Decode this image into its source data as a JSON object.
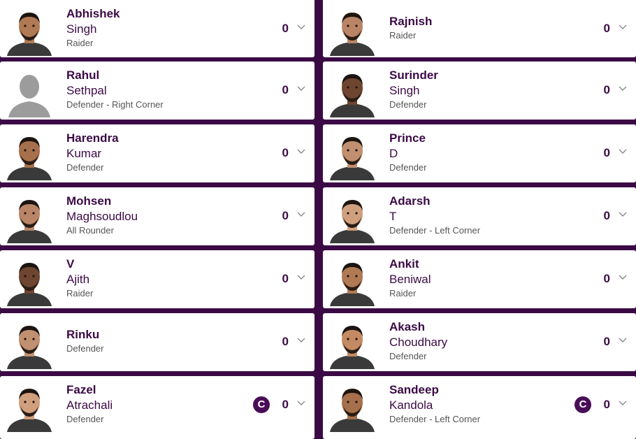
{
  "left": [
    {
      "first": "Abhishek",
      "last": "Singh",
      "role": "Raider",
      "points": "0",
      "avatar": "player-photo",
      "captain": null
    },
    {
      "first": "Rahul",
      "last": "Sethpal",
      "role": "Defender - Right Corner",
      "points": "0",
      "avatar": "placeholder-avatar",
      "captain": null
    },
    {
      "first": "Harendra",
      "last": "Kumar",
      "role": "Defender",
      "points": "0",
      "avatar": "player-photo",
      "captain": null
    },
    {
      "first": "Mohsen",
      "last": "Maghsoudlou",
      "role": "All Rounder",
      "points": "0",
      "avatar": "player-photo",
      "captain": null
    },
    {
      "first": "V",
      "last": "Ajith",
      "role": "Raider",
      "points": "0",
      "avatar": "player-photo",
      "captain": null
    },
    {
      "first": "Rinku",
      "last": "",
      "role": "Defender",
      "points": "0",
      "avatar": "player-photo",
      "captain": null
    },
    {
      "first": "Fazel",
      "last": "Atrachali",
      "role": "Defender",
      "points": "0",
      "avatar": "player-photo",
      "captain": "C"
    }
  ],
  "right": [
    {
      "first": "Rajnish",
      "last": "",
      "role": "Raider",
      "points": "0",
      "avatar": "player-photo",
      "captain": null
    },
    {
      "first": "Surinder",
      "last": "Singh",
      "role": "Defender",
      "points": "0",
      "avatar": "player-photo",
      "captain": null
    },
    {
      "first": "Prince",
      "last": "D",
      "role": "Defender",
      "points": "0",
      "avatar": "player-photo",
      "captain": null
    },
    {
      "first": "Adarsh",
      "last": "T",
      "role": "Defender - Left Corner",
      "points": "0",
      "avatar": "player-photo",
      "captain": null
    },
    {
      "first": "Ankit",
      "last": "Beniwal",
      "role": "Raider",
      "points": "0",
      "avatar": "player-photo",
      "captain": null
    },
    {
      "first": "Akash",
      "last": "Choudhary",
      "role": "Defender",
      "points": "0",
      "avatar": "player-photo",
      "captain": null
    },
    {
      "first": "Sandeep",
      "last": "Kandola",
      "role": "Defender - Left Corner",
      "points": "0",
      "avatar": "player-photo",
      "captain": "C"
    }
  ],
  "colors": {
    "background": "#3b0a45",
    "accent": "#4a0d57",
    "card": "#ffffff"
  },
  "icons": {
    "expand": "chevron-down-icon",
    "captain": "captain-badge"
  }
}
